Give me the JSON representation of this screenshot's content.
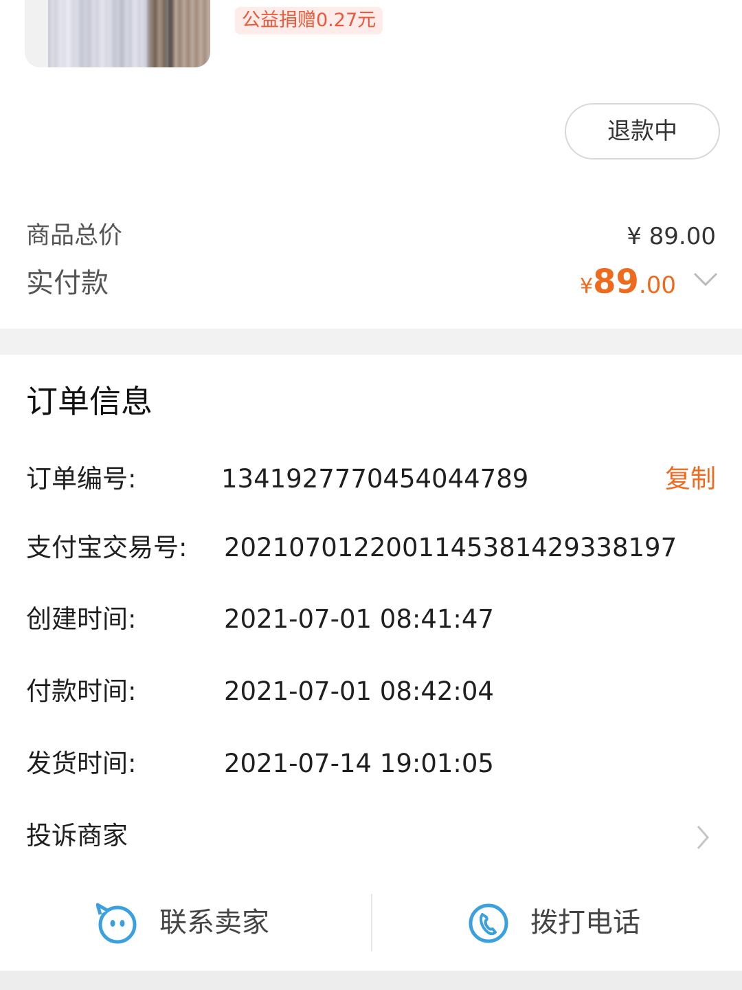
{
  "product": {
    "charity_badge": "公益捐赠0.27元",
    "refund_status_button": "退款中"
  },
  "summary": {
    "total_label": "商品总价",
    "total_value": "¥ 89.00",
    "paid_label": "实付款",
    "paid_currency": "¥",
    "paid_integer": "89",
    "paid_decimal": ".00",
    "accent_color": "#ee6a1f"
  },
  "order_info": {
    "title": "订单信息",
    "rows": [
      {
        "label": "订单编号:",
        "value": "1341927770454044789"
      },
      {
        "label": "支付宝交易号:",
        "value": "2021070122001145381429338197"
      },
      {
        "label": "创建时间:",
        "value": "2021-07-01 08:41:47"
      },
      {
        "label": "付款时间:",
        "value": "2021-07-01 08:42:04"
      },
      {
        "label": "发货时间:",
        "value": "2021-07-14 19:01:05"
      }
    ],
    "copy_label": "复制",
    "complain_label": "投诉商家"
  },
  "actions": {
    "contact_seller": {
      "label": "联系卖家",
      "icon": "chat-face-icon"
    },
    "call_phone": {
      "label": "拨打电话",
      "icon": "phone-icon"
    },
    "icon_color": "#3aa0e0"
  }
}
